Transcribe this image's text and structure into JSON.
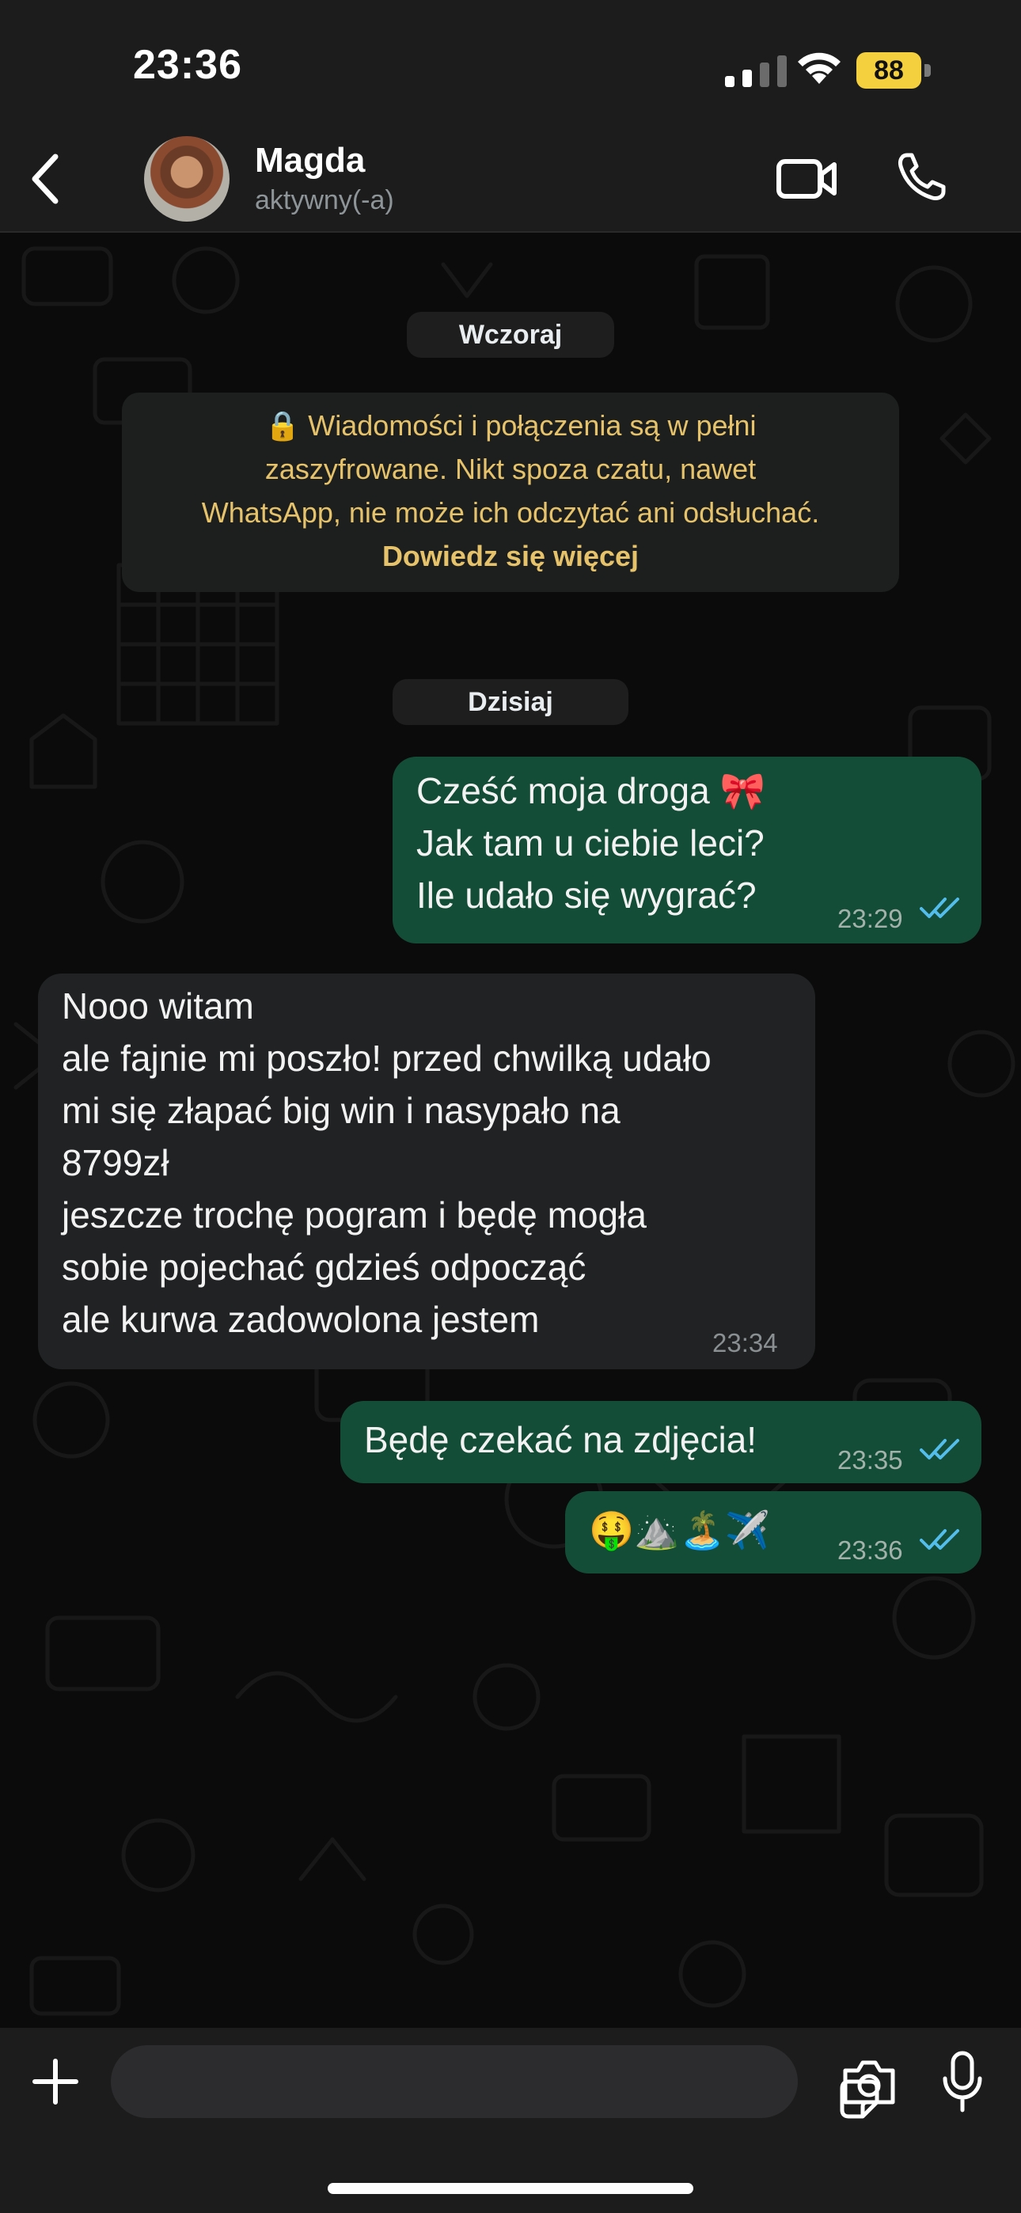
{
  "status_bar": {
    "time": "23:36",
    "battery": "88"
  },
  "header": {
    "contact_name": "Magda",
    "presence": "aktywny(-a)"
  },
  "chat": {
    "date_yesterday": "Wczoraj",
    "encryption_notice": {
      "lines": [
        "🔒 Wiadomości i połączenia są w pełni",
        "zaszyfrowane. Nikt spoza czatu, nawet",
        "WhatsApp, nie może ich odczytać ani odsłuchać."
      ],
      "link": "Dowiedz się więcej"
    },
    "date_today": "Dzisiaj",
    "messages": [
      {
        "direction": "out",
        "text": "Cześć moja droga 🎀\nJak tam u ciebie leci?\nIle udało się wygrać?",
        "time": "23:29",
        "status": "read"
      },
      {
        "direction": "in",
        "text": "Nooo witam\nale fajnie mi poszło! przed chwilką udało\nmi się złapać big win i nasypało na\n8799zł\njeszcze trochę pogram i będę mogła\nsobie pojechać gdzieś odpocząć\nale kurwa zadowolona jestem",
        "time": "23:34"
      },
      {
        "direction": "out",
        "text": "Będę czekać na zdjęcia!",
        "time": "23:35",
        "status": "read"
      },
      {
        "direction": "out",
        "text": "🤑⛰️🏝️✈️",
        "time": "23:36",
        "status": "read"
      }
    ]
  },
  "composer": {
    "placeholder": ""
  },
  "colors": {
    "outgoing_bubble": "#144d37",
    "incoming_bubble": "#202224",
    "notice_text": "#e6c36a",
    "read_ticks": "#53bdeb",
    "battery": "#f4d03f"
  },
  "icons": [
    "back-chevron-icon",
    "video-call-icon",
    "phone-icon",
    "plus-icon",
    "sticker-icon",
    "camera-icon",
    "microphone-icon",
    "signal-icon",
    "wifi-icon",
    "lock-icon"
  ]
}
